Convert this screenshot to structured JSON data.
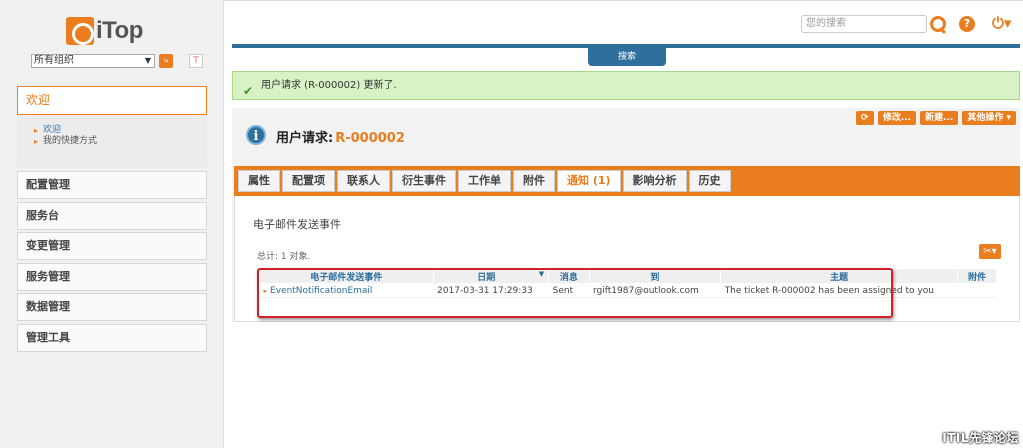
{
  "app": {
    "logo_text": "iTop"
  },
  "sidebar": {
    "org_select": "所有组织",
    "welcome": "欢迎",
    "submenu": [
      "欢迎",
      "我的快捷方式"
    ],
    "items": [
      "配置管理",
      "服务台",
      "变更管理",
      "服务管理",
      "数据管理",
      "管理工具"
    ]
  },
  "header": {
    "search_placeholder": "您的搜索",
    "search_tab": "搜索"
  },
  "message": "用户请求 (R-000002) 更新了.",
  "object": {
    "label": "用户请求:",
    "ref": "R-000002",
    "actions": [
      "修改...",
      "新建...",
      "其他操作 ▾"
    ]
  },
  "tabs": [
    {
      "label": "属性",
      "active": false
    },
    {
      "label": "配置项",
      "active": false
    },
    {
      "label": "联系人",
      "active": false
    },
    {
      "label": "衍生事件",
      "active": false
    },
    {
      "label": "工作单",
      "active": false
    },
    {
      "label": "附件",
      "active": false
    },
    {
      "label": "通知 (1)",
      "active": true
    },
    {
      "label": "影响分析",
      "active": false
    },
    {
      "label": "历史",
      "active": false
    }
  ],
  "panel": {
    "title": "电子邮件发送事件",
    "total": "总计: 1 对象.",
    "columns": [
      "电子邮件发送事件",
      "日期",
      "消息",
      "到",
      "主题",
      "附件"
    ],
    "rows": [
      {
        "event": "EventNotificationEmail",
        "date": "2017-03-31 17:29:33",
        "message": "Sent",
        "to": "rgift1987@outlook.com",
        "subject": "The ticket R-000002 has been assigned to you",
        "attachment": ""
      }
    ]
  },
  "watermark": "ITIL先锋论坛",
  "colors": {
    "accent": "#ea7d1e",
    "blue": "#2e6f9e",
    "success_bg": "#d8f2c6",
    "highlight": "#d11f2a"
  }
}
